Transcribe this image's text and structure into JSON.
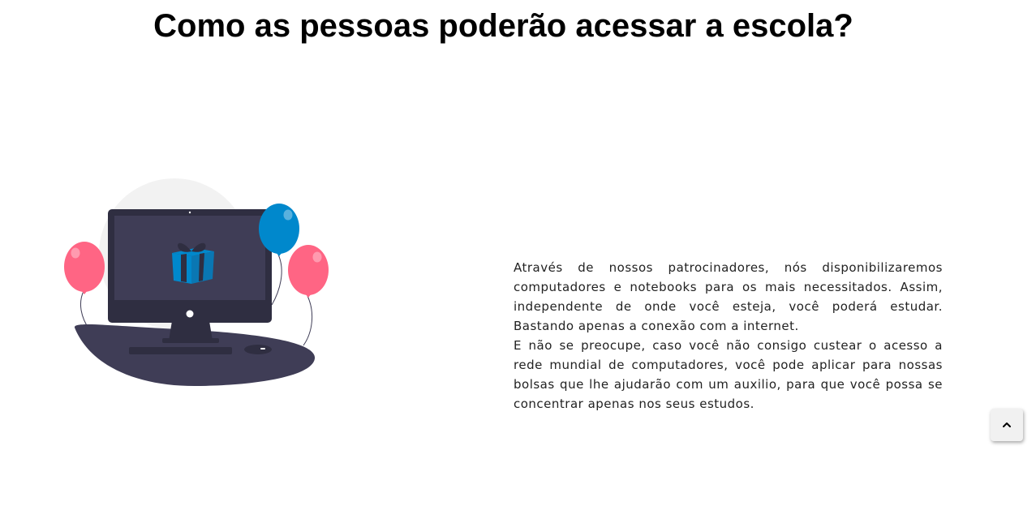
{
  "section": {
    "title": "Como as pessoas poderão acessar a escola?",
    "paragraphs": [
      "Através de nossos patrocinadores, nós disponibilizaremos computadores e notebooks para os mais necessitados. Assim, independente de onde você esteja, você poderá estudar. Bastando apenas a conexão com a internet.",
      "E não se preocupe, caso você não consigo custear o acesso a rede mundial de computadores, você pode aplicar para nossas bolsas que lhe ajudarão com um auxilio, para que você possa se concentrar apenas nos seus estudos."
    ]
  },
  "illustration": {
    "icon": "computer-gift-balloons-illustration",
    "colors": {
      "desk": "#3f3d56",
      "monitor": "#2f2e41",
      "screen": "#3f3d56",
      "gift": "#0088cc",
      "balloon_pink": "#ff6584",
      "balloon_blue": "#0088cc",
      "background_circle": "#f2f2f2"
    }
  },
  "back_to_top": {
    "icon": "chevron-up-icon"
  }
}
